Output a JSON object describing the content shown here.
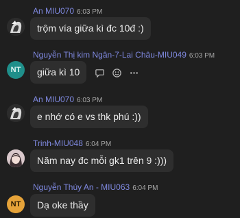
{
  "messages": [
    {
      "author": "An MIU070",
      "time": "6:03 PM",
      "text": "trộm vía giữa kì đc 10đ :)",
      "avatar": "anime-avatar"
    },
    {
      "author": "Nguyễn Thị kim Ngân-7-Lai Châu-MIU049",
      "time": "6:03 PM",
      "text": "giữa kì 10",
      "avatar_initials": "NT"
    },
    {
      "author": "An MIU070",
      "time": "6:03 PM",
      "text": "e nhớ có e vs thk phú :))",
      "avatar": "anime-avatar"
    },
    {
      "author": "Trinh-MIU048",
      "time": "6:04 PM",
      "text": "Năm nay đc mỗi gk1 trên 9 :)))",
      "avatar": "photo-avatar"
    },
    {
      "author": "Nguyễn Thúy An - MIU063",
      "time": "6:04 PM",
      "text": "Dạ oke thầy",
      "avatar_initials": "NT"
    }
  ],
  "hover_tools": [
    "reply-icon",
    "react-icon",
    "more-icon"
  ]
}
